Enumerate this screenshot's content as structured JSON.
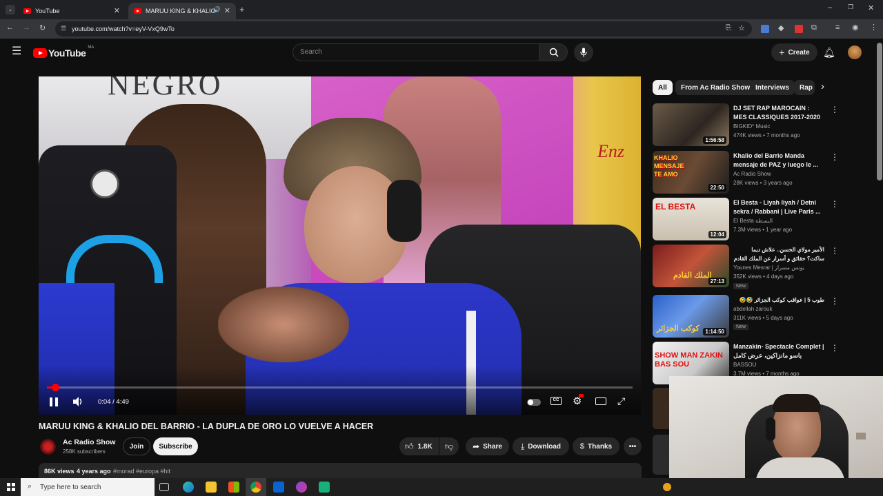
{
  "browser": {
    "tabs": [
      {
        "label": "YouTube",
        "active": false
      },
      {
        "label": "MARUU KING & KHALIO DEL",
        "active": true
      }
    ],
    "url": "youtube.com/watch?v=eyV-VxQ9wTo"
  },
  "header": {
    "logo_text": "YouTube",
    "country_code": "MA",
    "search_placeholder": "Search",
    "create_label": "Create"
  },
  "player": {
    "time": "0:04 / 4:49",
    "progress_fraction": 0.014,
    "overlay_text_left": "NEGRO",
    "overlay_text_right": "Enz"
  },
  "video": {
    "title": "MARUU KING & KHALIO DEL BARRIO - LA DUPLA DE ORO LO VUELVE A HACER",
    "channel": "Ac Radio Show",
    "subscribers": "258K subscribers",
    "join_label": "Join",
    "subscribe_label": "Subscribe",
    "likes": "1.8K",
    "share_label": "Share",
    "download_label": "Download",
    "thanks_label": "Thanks",
    "views": "86K views",
    "age": "4 years ago",
    "hashtags": "#morad #europa #hit"
  },
  "chips": [
    "All",
    "From Ac Radio Show",
    "Interviews",
    "Rap"
  ],
  "recommendations": [
    {
      "title": "DJ SET RAP MAROCAIN : MES CLASSIQUES 2017-2020",
      "channel": "BIGKID* Music",
      "meta": "474K views • 7 months ago",
      "duration": "1:56:58",
      "badge": "",
      "thumb_text": ""
    },
    {
      "title": "Khalio del Barrio Manda mensaje de PAZ y luego le ...",
      "channel": "Ac Radio Show",
      "meta": "28K views • 3 years ago",
      "duration": "22:50",
      "badge": "",
      "thumb_text": "KHALIO MENSAJE TE AMO"
    },
    {
      "title": "El Besta - Liyah liyah / Detni sekra / Rabbani | Live Paris ...",
      "channel": "El Besta البسطة",
      "meta": "7.3M views • 1 year ago",
      "duration": "12:04",
      "badge": "",
      "thumb_text": "EL BESTA"
    },
    {
      "title": "الأمير مولاي الحسن.. علاش ديما ساكت؟ حقائق و أسرار عن الملك القادم للمغرب",
      "channel": "Younes Mesrar | يونس مسرار",
      "meta": "352K views • 4 days ago",
      "duration": "27:13",
      "badge": "New",
      "thumb_text": "الملك القادم"
    },
    {
      "title": "طوب 5 | عواقب كوكب الجزائر 🤣🤣",
      "channel": "abdellah zarouk",
      "meta": "311K views • 5 days ago",
      "duration": "1:14:50",
      "badge": "New",
      "thumb_text": "كوكب الجزائر"
    },
    {
      "title": "Manzakin- Spectacle Complet | باسو مانزاكين، عرض كامل",
      "channel": "BASSOU",
      "meta": "3.7M views • 7 months ago",
      "duration": "",
      "badge": "",
      "thumb_text": "SHOW MAN ZAKIN BAS SOU"
    }
  ],
  "taskbar": {
    "search_placeholder": "Type here to search"
  },
  "colors": {
    "background": "#0f0f0f",
    "youtube_red": "#ff0000",
    "surface": "#272727",
    "text": "#f1f1f1",
    "muted": "#aaaaaa"
  }
}
